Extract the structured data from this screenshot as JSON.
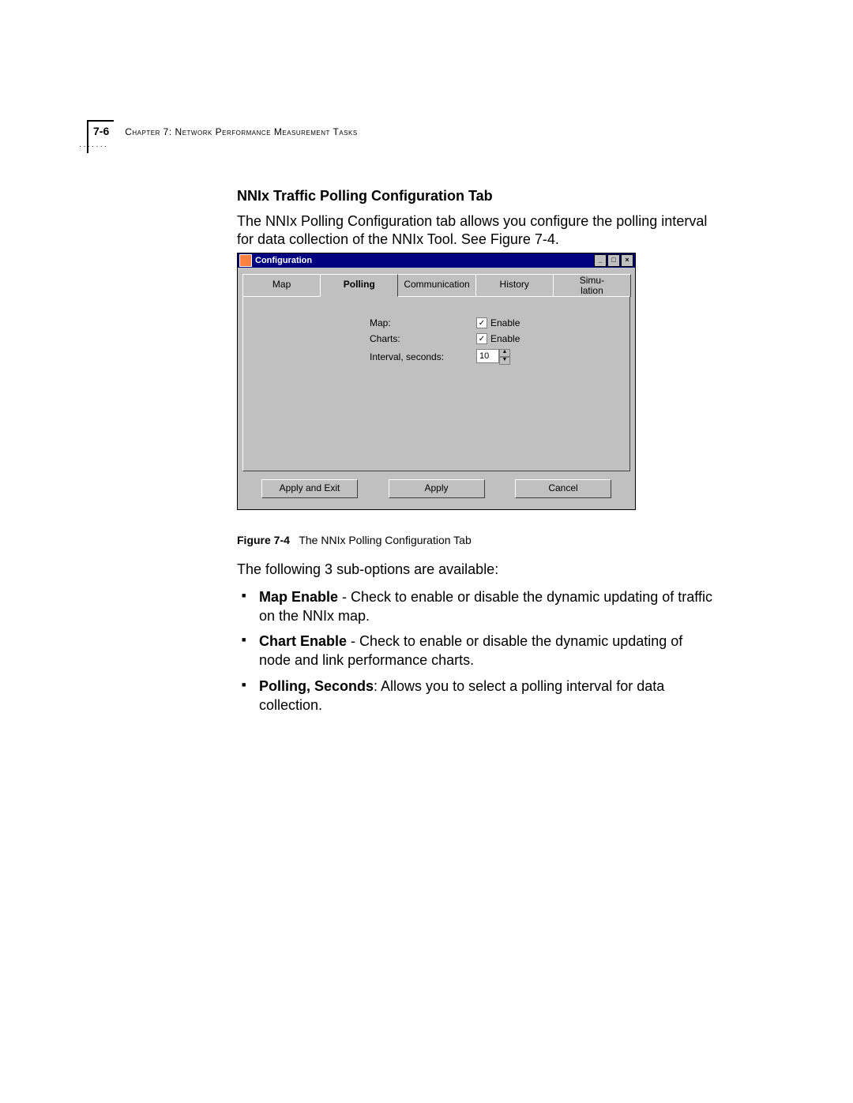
{
  "header": {
    "page_number": "7-6",
    "chapter": "Chapter 7: Network Performance Measurement Tasks"
  },
  "section": {
    "title": "NNIx Traffic Polling Configuration Tab",
    "intro": "The NNIx Polling Configuration tab allows you configure the polling interval for data collection of the NNIx Tool. See Figure 7-4."
  },
  "dialog": {
    "title": "Configuration",
    "window_controls": {
      "min": "_",
      "max": "□",
      "close": "×"
    },
    "tabs": {
      "map": "Map",
      "polling": "Polling",
      "communication": "Communication",
      "history": "History",
      "simulation": "Simu-\nlation"
    },
    "active_tab": "polling",
    "fields": {
      "map_label": "Map:",
      "map_enable_label": "Enable",
      "map_enable_checked": true,
      "charts_label": "Charts:",
      "charts_enable_label": "Enable",
      "charts_enable_checked": true,
      "interval_label": "Interval, seconds:",
      "interval_value": "10"
    },
    "buttons": {
      "apply_exit": "Apply and Exit",
      "apply": "Apply",
      "cancel": "Cancel"
    }
  },
  "figure_caption": {
    "label": "Figure 7-4",
    "text": "The NNIx Polling Configuration Tab"
  },
  "subtext": "The following 3 sub-options are available:",
  "options": {
    "o1_label": "Map Enable",
    "o1_text": " - Check to enable or disable the dynamic updating of traffic on the NNIx map.",
    "o2_label": "Chart Enable",
    "o2_text": " - Check to enable or disable the dynamic updating of node and link performance charts.",
    "o3_label": "Polling, Seconds",
    "o3_text": ": Allows you to select a polling interval for data collection."
  }
}
